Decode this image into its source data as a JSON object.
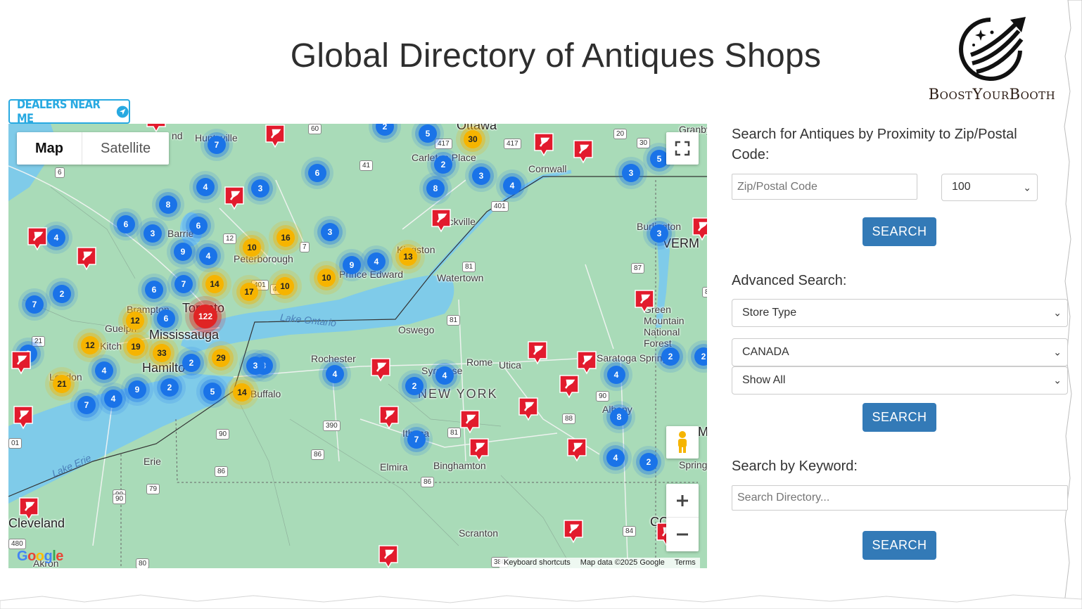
{
  "page": {
    "title": "Global Directory of Antiques Shops"
  },
  "logo": {
    "text": "BoostYourBooth"
  },
  "dealers_button": {
    "label": "DEALERS NEAR ME"
  },
  "map": {
    "type_controls": {
      "map": "Map",
      "satellite": "Satellite"
    },
    "attribution": {
      "shortcuts": "Keyboard shortcuts",
      "data": "Map data ©2025 Google",
      "terms": "Terms"
    },
    "google_logo": "Google",
    "places": {
      "ottawa": "Ottawa",
      "granby": "Granby",
      "carleton_place": "Carleton Place",
      "cornwall": "Cornwall",
      "huntsville": "Huntsville",
      "nd": "nd",
      "barrie": "Barrie",
      "peterborough": "Peterborough",
      "brockville": "Brockville",
      "kingston": "Kingston",
      "prince_edward": "Prince Edward",
      "watertown": "Watertown",
      "burlington": "Burlington",
      "verm": "VERM",
      "brampton": "Brampton",
      "toronto": "Toronto",
      "mississauga": "Mississauga",
      "guelph": "Guelph",
      "kitchener": "Kitch",
      "hamilton": "Hamilto",
      "london": "London",
      "lake_ontario": "Lake Ontario",
      "oswego": "Oswego",
      "rochester": "Rochester",
      "syracuse": "Syracuse",
      "rome": "Rome",
      "utica": "Utica",
      "new_york": "NEW YORK",
      "saratoga": "Saratoga Springs",
      "albany": "Albany",
      "green_mountain": "Green Mountain National Forest",
      "buffalo": "Buffalo",
      "erie": "Erie",
      "lake_erie": "Lake Erie",
      "ithaca": "Ithaca",
      "elmira": "Elmira",
      "binghamton": "Binghamton",
      "springfield": "Spring",
      "cleveland": "Cleveland",
      "akron": "Akron",
      "scranton": "Scranton",
      "co": "CO",
      "m": "M"
    },
    "road_labels": [
      "60",
      "417",
      "417",
      "41",
      "6",
      "12",
      "7",
      "401",
      "81",
      "87",
      "89",
      "40",
      "401",
      "81",
      "90",
      "21",
      "90",
      "86",
      "86",
      "390",
      "81",
      "88",
      "90",
      "79",
      "90",
      "86",
      "84",
      "380",
      "80",
      "480",
      "01",
      "20",
      "30"
    ],
    "clusters": [
      {
        "v": "2",
        "c": "blue"
      },
      {
        "v": "5",
        "c": "blue"
      },
      {
        "v": "30",
        "c": "yellow"
      },
      {
        "v": "7",
        "c": "blue"
      },
      {
        "v": "2",
        "c": "blue"
      },
      {
        "v": "3",
        "c": "blue"
      },
      {
        "v": "8",
        "c": "blue"
      },
      {
        "v": "4",
        "c": "blue"
      },
      {
        "v": "3",
        "c": "blue"
      },
      {
        "v": "5",
        "c": "blue"
      },
      {
        "v": "6",
        "c": "blue"
      },
      {
        "v": "4",
        "c": "blue"
      },
      {
        "v": "3",
        "c": "blue"
      },
      {
        "v": "8",
        "c": "blue"
      },
      {
        "v": "6",
        "c": "blue"
      },
      {
        "v": "3",
        "c": "blue"
      },
      {
        "v": "6",
        "c": "blue"
      },
      {
        "v": "4",
        "c": "blue"
      },
      {
        "v": "9",
        "c": "blue"
      },
      {
        "v": "4",
        "c": "blue"
      },
      {
        "v": "10",
        "c": "yellow"
      },
      {
        "v": "16",
        "c": "yellow"
      },
      {
        "v": "3",
        "c": "blue"
      },
      {
        "v": "13",
        "c": "yellow"
      },
      {
        "v": "4",
        "c": "blue"
      },
      {
        "v": "9",
        "c": "blue"
      },
      {
        "v": "10",
        "c": "yellow"
      },
      {
        "v": "3",
        "c": "blue"
      },
      {
        "v": "6",
        "c": "blue"
      },
      {
        "v": "7",
        "c": "blue"
      },
      {
        "v": "14",
        "c": "yellow"
      },
      {
        "v": "17",
        "c": "yellow"
      },
      {
        "v": "10",
        "c": "yellow"
      },
      {
        "v": "2",
        "c": "blue"
      },
      {
        "v": "7",
        "c": "blue"
      },
      {
        "v": "6",
        "c": "blue"
      },
      {
        "v": "122",
        "c": "red"
      },
      {
        "v": "12",
        "c": "yellow"
      },
      {
        "v": "9",
        "c": "blue"
      },
      {
        "v": "3",
        "c": "blue"
      },
      {
        "v": "12",
        "c": "yellow"
      },
      {
        "v": "19",
        "c": "yellow"
      },
      {
        "v": "33",
        "c": "yellow"
      },
      {
        "v": "29",
        "c": "yellow"
      },
      {
        "v": "2",
        "c": "blue"
      },
      {
        "v": "3",
        "c": "blue"
      },
      {
        "v": "4",
        "c": "blue"
      },
      {
        "v": "21",
        "c": "yellow"
      },
      {
        "v": "9",
        "c": "blue"
      },
      {
        "v": "2",
        "c": "blue"
      },
      {
        "v": "5",
        "c": "blue"
      },
      {
        "v": "14",
        "c": "yellow"
      },
      {
        "v": "4",
        "c": "blue"
      },
      {
        "v": "7",
        "c": "blue"
      },
      {
        "v": "4",
        "c": "blue"
      },
      {
        "v": "2",
        "c": "blue"
      },
      {
        "v": "4",
        "c": "blue"
      },
      {
        "v": "2",
        "c": "blue"
      },
      {
        "v": "4",
        "c": "blue"
      },
      {
        "v": "8",
        "c": "blue"
      },
      {
        "v": "7",
        "c": "blue"
      },
      {
        "v": "4",
        "c": "blue"
      },
      {
        "v": "2",
        "c": "blue"
      },
      {
        "v": "2",
        "c": "blue"
      }
    ]
  },
  "proximity_search": {
    "heading": "Search for Antiques by Proximity to Zip/Postal Code:",
    "zip_placeholder": "Zip/Postal Code",
    "radius_value": "100",
    "button": "SEARCH"
  },
  "advanced_search": {
    "heading": "Advanced Search:",
    "store_type": "Store Type",
    "country": "CANADA",
    "show": "Show All",
    "button": "SEARCH"
  },
  "keyword_search": {
    "heading": "Search by Keyword:",
    "placeholder": "Search Directory...",
    "button": "SEARCH"
  },
  "colors": {
    "button_blue": "#337ab7",
    "dealers_blue": "#27a9e1",
    "cluster_blue": "#1a73e8",
    "cluster_yellow": "#f6b400",
    "cluster_red": "#e02424",
    "pin_red": "#e21b2d",
    "land": "#a7dcb6",
    "water": "#7fcbe9"
  }
}
